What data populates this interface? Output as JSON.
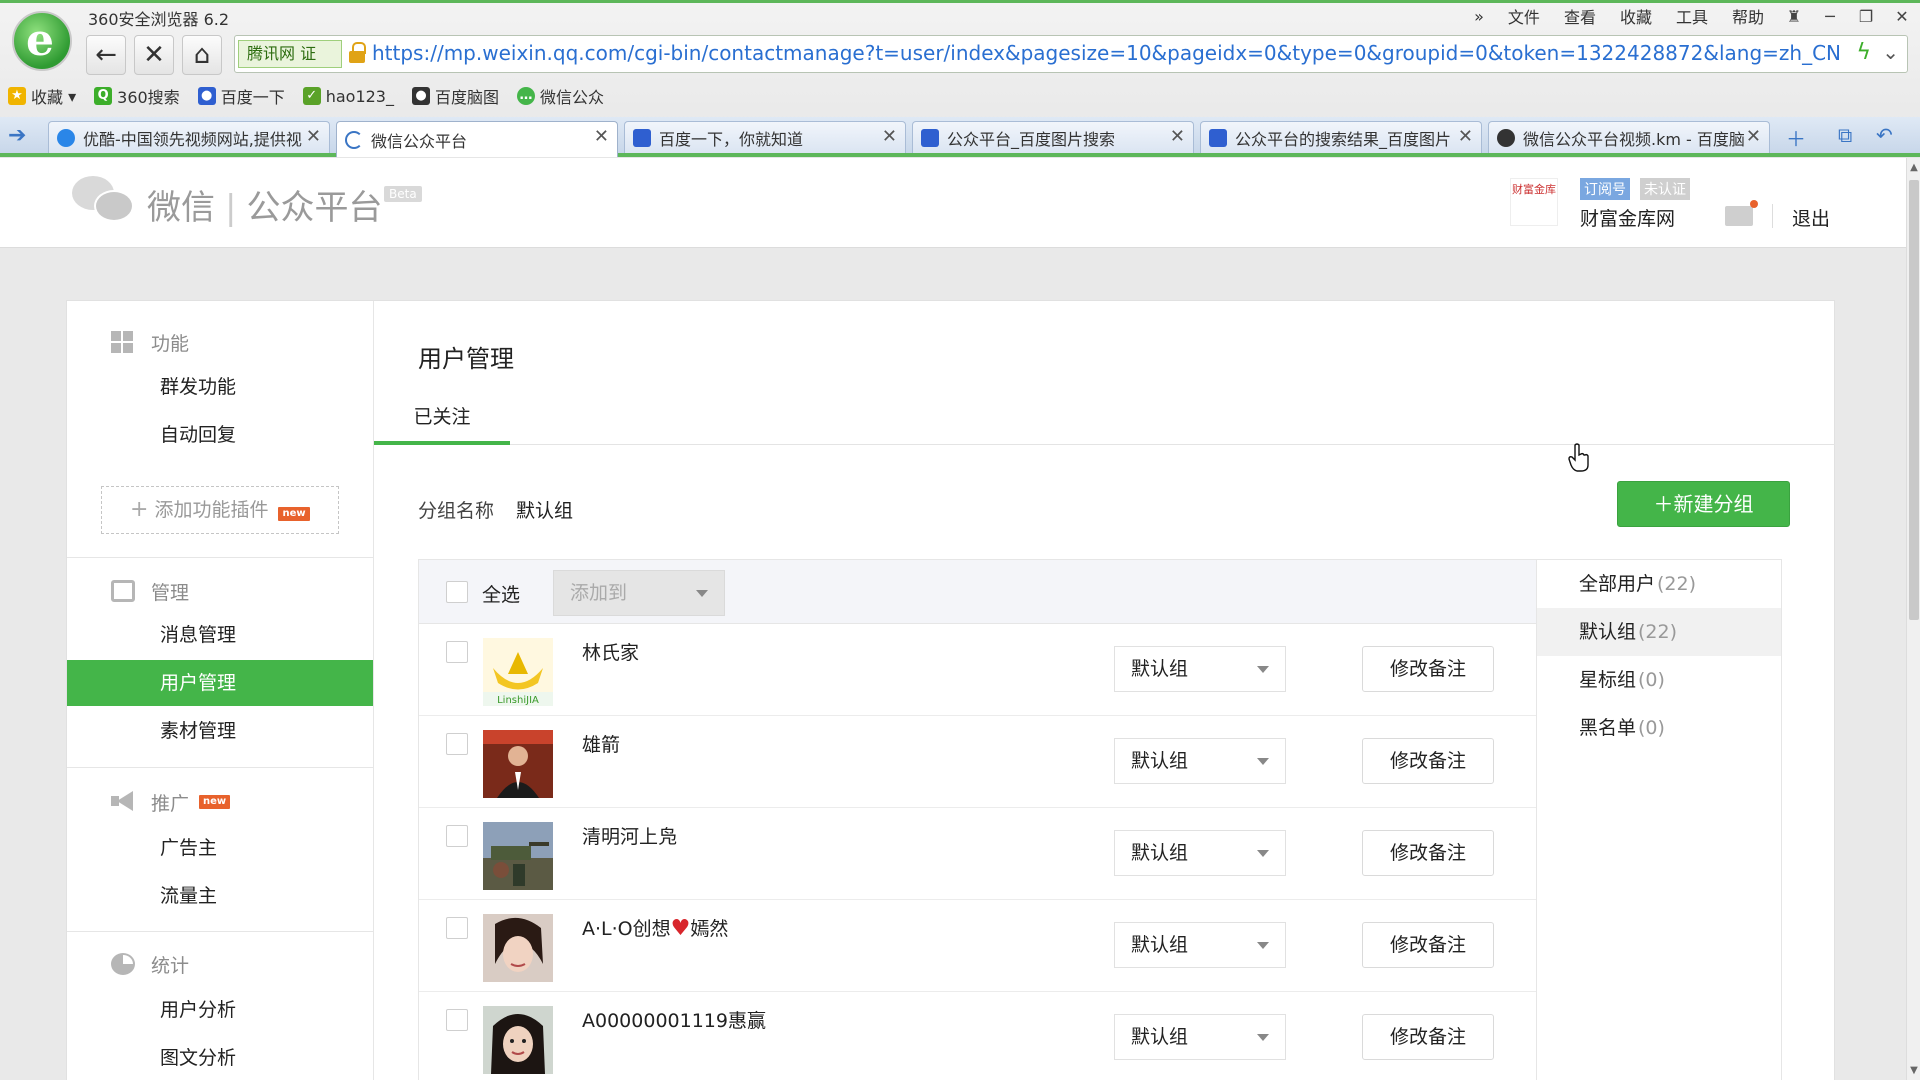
{
  "browser": {
    "title": "360安全浏览器 6.2",
    "menu": [
      "文件",
      "查看",
      "收藏",
      "工具",
      "帮助"
    ],
    "url": "https://mp.weixin.qq.com/cgi-bin/contactmanage?t=user/index&pagesize=10&pageidx=0&type=0&groupid=0&token=1322428872&lang=zh_CN",
    "address_badge": "腾讯网 证",
    "bookmarks": [
      "收藏",
      "360搜索",
      "百度一下",
      "hao123_",
      "百度脑图",
      "微信公众"
    ],
    "tabs": [
      {
        "label": "优酷-中国领先视频网站,提供视",
        "active": false
      },
      {
        "label": "微信公众平台",
        "active": true
      },
      {
        "label": "百度一下，你就知道",
        "active": false
      },
      {
        "label": "公众平台_百度图片搜索",
        "active": false
      },
      {
        "label": "公众平台的搜索结果_百度图片",
        "active": false
      },
      {
        "label": "微信公众平台视频.km - 百度脑",
        "active": false
      }
    ]
  },
  "header": {
    "brand_weixin": "微信",
    "brand_platform": "公众平台",
    "beta": "Beta",
    "badge_subscription": "订阅号",
    "badge_unverified": "未认证",
    "account_name": "财富金库网",
    "logout": "退出",
    "account_logo_text": "财富金库"
  },
  "sidebar": {
    "functions_head": "功能",
    "mass_send": "群发功能",
    "auto_reply": "自动回复",
    "add_plugin": "添加功能插件",
    "new_badge": "new",
    "manage_head": "管理",
    "message_manage": "消息管理",
    "user_manage": "用户管理",
    "material_manage": "素材管理",
    "promote_head": "推广",
    "advertiser": "广告主",
    "traffic_owner": "流量主",
    "stats_head": "统计",
    "user_analysis": "用户分析",
    "article_analysis": "图文分析"
  },
  "content": {
    "title": "用户管理",
    "tab_followed": "已关注",
    "group_name_label": "分组名称",
    "group_name_value": "默认组",
    "new_group_button": "新建分组",
    "select_all": "全选",
    "add_to_placeholder": "添加到",
    "remark_button": "修改备注",
    "users": [
      {
        "name": "林氏家",
        "group": "默认组"
      },
      {
        "name": "雄箭",
        "group": "默认组"
      },
      {
        "name": "清明河上凫",
        "group": "默认组"
      },
      {
        "name_prefix": "A·L·O创想",
        "name_suffix": "嫣然",
        "group": "默认组"
      },
      {
        "name": "A00000001119惠赢",
        "group": "默认组"
      }
    ]
  },
  "groups": [
    {
      "name": "全部用户",
      "count": "(22)"
    },
    {
      "name": "默认组",
      "count": "(22)"
    },
    {
      "name": "星标组",
      "count": "(0)"
    },
    {
      "name": "黑名单",
      "count": "(0)"
    }
  ],
  "colors": {
    "accent_green": "#44b549",
    "new_badge": "#e8622c",
    "url_blue": "#2a6fd1"
  }
}
